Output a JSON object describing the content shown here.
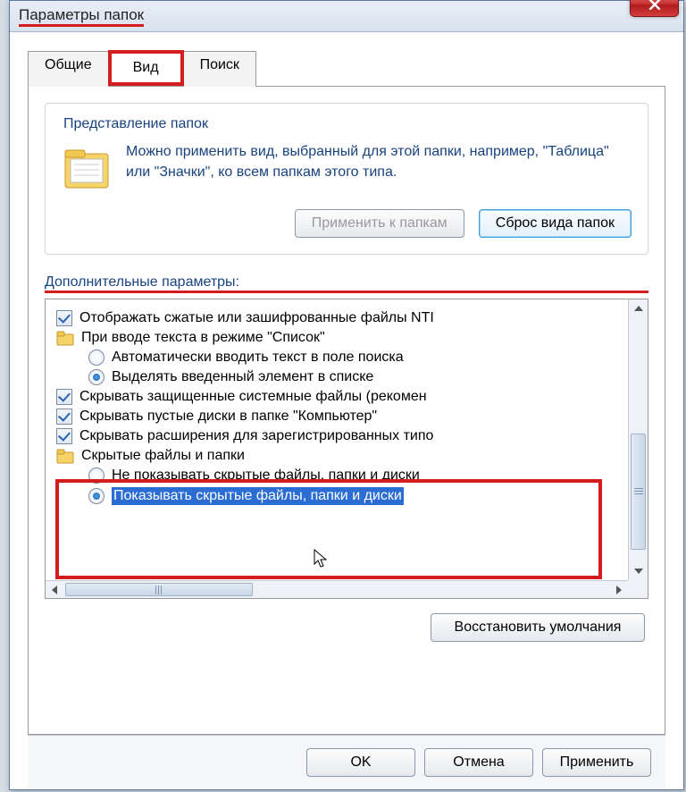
{
  "title": "Параметры папок",
  "tabs": {
    "general": "Общие",
    "view": "Вид",
    "search": "Поиск"
  },
  "fieldset": {
    "legend": "Представление папок",
    "text": "Можно применить вид, выбранный для этой папки, например, \"Таблица\" или \"Значки\", ко всем папкам этого типа.",
    "apply": "Применить к папкам",
    "reset": "Сброс вида папок"
  },
  "advanced_label": "Дополнительные параметры:",
  "tree": {
    "i0": "Отображать сжатые или зашифрованные файлы NTI",
    "i1": "При вводе текста в режиме \"Список\"",
    "i1a": "Автоматически вводить текст в поле поиска",
    "i1b": "Выделять введенный элемент в списке",
    "i2": "Скрывать защищенные системные файлы (рекомен",
    "i3": "Скрывать пустые диски в папке \"Компьютер\"",
    "i4": "Скрывать расширения для зарегистрированных типо",
    "i5": "Скрытые файлы и папки",
    "i5a": "Не показывать скрытые файлы, папки и диски",
    "i5b": "Показывать скрытые файлы, папки и диски"
  },
  "restore": "Восстановить умолчания",
  "footer": {
    "ok": "OK",
    "cancel": "Отмена",
    "apply": "Применить"
  }
}
